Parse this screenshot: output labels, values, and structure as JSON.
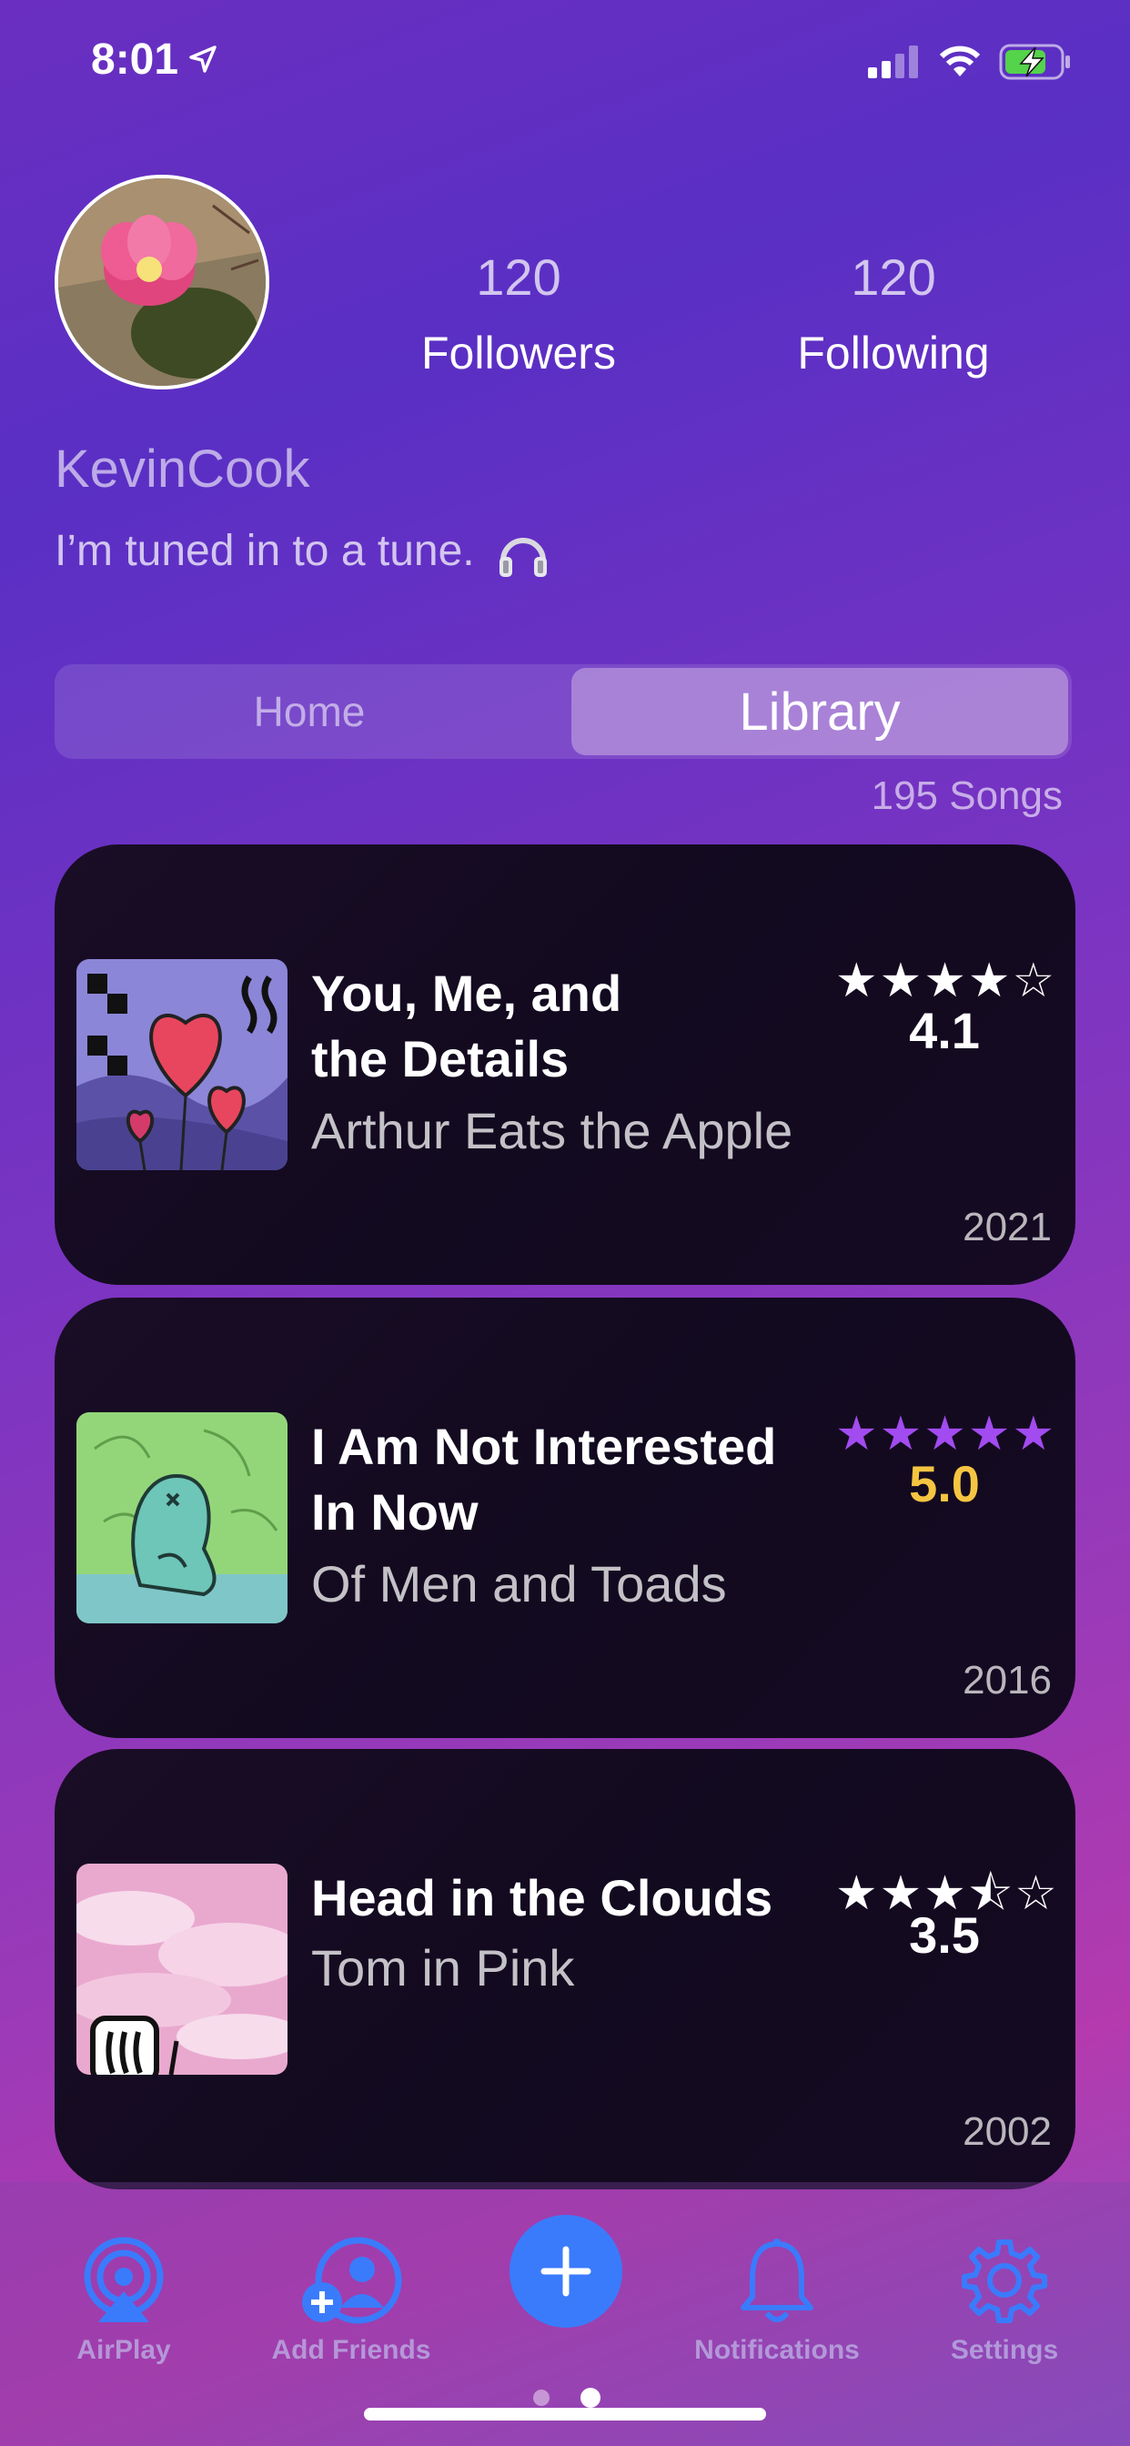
{
  "status_bar": {
    "time": "8:01"
  },
  "profile": {
    "followers_count": "120",
    "followers_label": "Followers",
    "following_count": "120",
    "following_label": "Following",
    "username": "KevinCook",
    "bio": "I’m tuned in to a tune."
  },
  "segment": {
    "home": "Home",
    "library": "Library",
    "selected": "Library"
  },
  "library": {
    "count": "195 Songs",
    "songs": [
      {
        "title_line1": "You, Me, and",
        "title_line2": "the Details",
        "artist": "Arthur Eats the Apple",
        "stars": "★★★★☆",
        "rating": "4.1",
        "year": "2021"
      },
      {
        "title_line1": "I Am Not Interested",
        "title_line2": "In Now",
        "artist": "Of Men and Toads",
        "stars": "★★★★★",
        "rating": "5.0",
        "year": "2016"
      },
      {
        "title_line1": "Head in the Clouds",
        "title_line2": "",
        "artist": "Tom in Pink",
        "stars": "★★★⯪☆",
        "rating": "3.5",
        "year": "2002"
      }
    ]
  },
  "tab_bar": {
    "airplay": "AirPlay",
    "add_friends": "Add Friends",
    "notifications": "Notifications",
    "settings": "Settings"
  },
  "colors": {
    "accent_blue": "#3a7bfc",
    "gold": "#f5c542",
    "purple_star": "#a24bf0"
  }
}
